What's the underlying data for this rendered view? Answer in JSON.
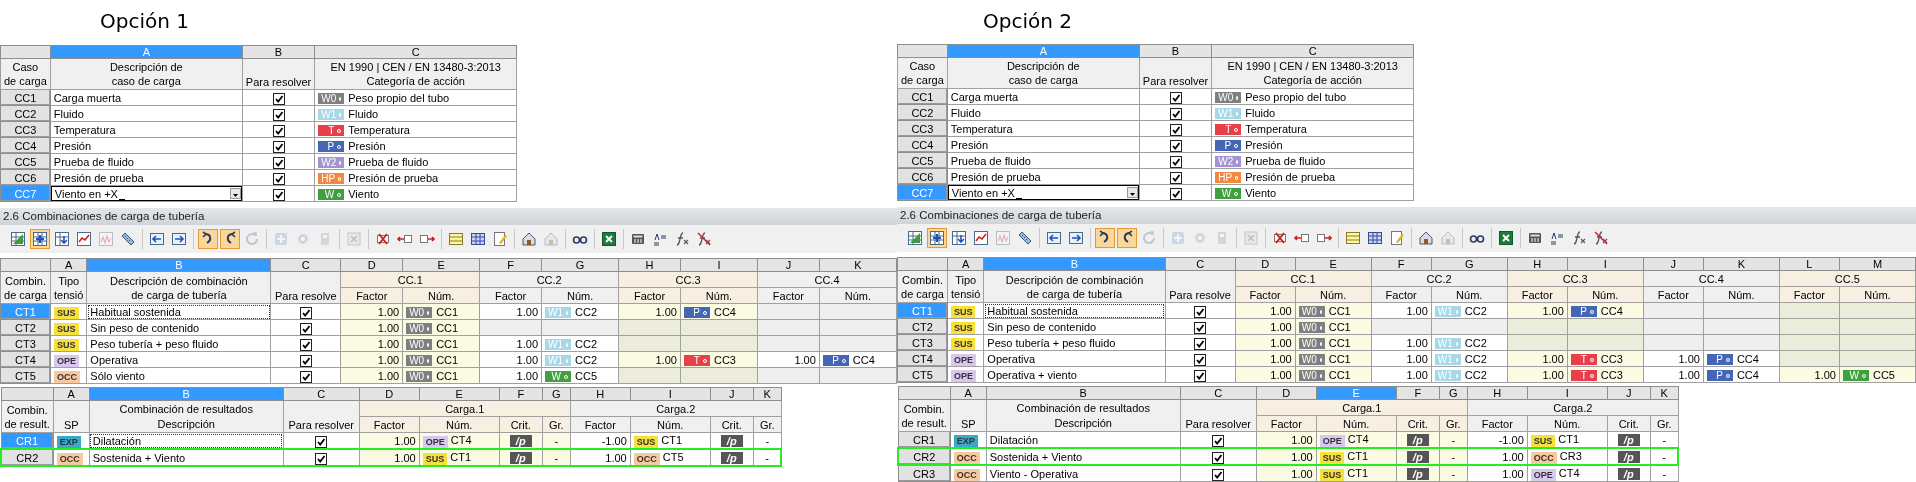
{
  "panels": [
    {
      "title": "Opción 1",
      "load_cases": {
        "corner": "Caso\nde carga",
        "columns": [
          {
            "letter": "A",
            "selected": true,
            "heading": "Descripción de\ncaso de carga"
          },
          {
            "letter": "B",
            "selected": false,
            "heading": "Para resolver"
          },
          {
            "letter": "C",
            "selected": false,
            "heading": "EN 1990 | CEN / EN 13480-3:2013\nCategoría de acción"
          }
        ],
        "rows": [
          {
            "id": "CC1",
            "selected": false,
            "description": "Carga muerta",
            "editing": false,
            "to_solve": true,
            "category": {
              "code": "W0",
              "color": "#7f7f7f",
              "label": "Peso propio del tubo"
            }
          },
          {
            "id": "CC2",
            "selected": false,
            "description": "Fluido",
            "editing": false,
            "to_solve": true,
            "category": {
              "code": "W1",
              "color": "#a6d8e8",
              "label": "Fluido"
            }
          },
          {
            "id": "CC3",
            "selected": false,
            "description": "Temperatura",
            "editing": false,
            "to_solve": true,
            "category": {
              "code": "T",
              "color": "#e8404a",
              "label": "Temperatura"
            }
          },
          {
            "id": "CC4",
            "selected": false,
            "description": "Presión",
            "editing": false,
            "to_solve": true,
            "category": {
              "code": "P",
              "color": "#4466b4",
              "label": "Presión"
            }
          },
          {
            "id": "CC5",
            "selected": false,
            "description": "Prueba de fluido",
            "editing": false,
            "to_solve": true,
            "category": {
              "code": "W2",
              "color": "#a294d0",
              "label": "Prueba de fluido"
            }
          },
          {
            "id": "CC6",
            "selected": false,
            "description": "Presión de prueba",
            "editing": false,
            "to_solve": true,
            "category": {
              "code": "HP",
              "color": "#f08840",
              "label": "Presión de prueba"
            }
          },
          {
            "id": "CC7",
            "selected": true,
            "description": "Viento en +X",
            "editing": true,
            "to_solve": true,
            "category": {
              "code": "W",
              "color": "#40a040",
              "label": "Viento"
            }
          }
        ]
      },
      "combinations": {
        "title": "2.6 Combinaciones de carga de tubería",
        "toolbar": [
          [
            {
              "kind": "grid-add",
              "pressed": false,
              "disabled": false
            },
            {
              "kind": "grid-select",
              "pressed": true,
              "disabled": false
            },
            {
              "kind": "grid-down",
              "pressed": false,
              "disabled": false
            },
            {
              "kind": "chart-red",
              "pressed": false,
              "disabled": false
            },
            {
              "kind": "chart",
              "pressed": false,
              "disabled": true
            },
            {
              "kind": "ruler",
              "pressed": false,
              "disabled": false
            }
          ],
          [
            {
              "kind": "move-left",
              "pressed": false,
              "disabled": false
            },
            {
              "kind": "move-right",
              "pressed": false,
              "disabled": false
            }
          ],
          [
            {
              "kind": "undo",
              "pressed": true,
              "disabled": false
            },
            {
              "kind": "redo",
              "pressed": true,
              "disabled": false
            },
            {
              "kind": "refresh",
              "pressed": false,
              "disabled": true
            }
          ],
          [
            {
              "kind": "plus",
              "pressed": false,
              "disabled": true
            },
            {
              "kind": "gear",
              "pressed": false,
              "disabled": true
            },
            {
              "kind": "box",
              "pressed": false,
              "disabled": true
            }
          ],
          [
            {
              "kind": "cross",
              "pressed": false,
              "disabled": true
            }
          ],
          [
            {
              "kind": "delete",
              "pressed": false,
              "disabled": false
            },
            {
              "kind": "insert-left",
              "pressed": false,
              "disabled": false
            },
            {
              "kind": "insert-right",
              "pressed": false,
              "disabled": false
            }
          ],
          [
            {
              "kind": "table-yellow",
              "pressed": false,
              "disabled": false
            },
            {
              "kind": "table-blue",
              "pressed": false,
              "disabled": false
            },
            {
              "kind": "edit",
              "pressed": false,
              "disabled": false
            }
          ],
          [
            {
              "kind": "house",
              "pressed": false,
              "disabled": false
            },
            {
              "kind": "house",
              "pressed": false,
              "disabled": true
            }
          ],
          [
            {
              "kind": "glasses",
              "pressed": false,
              "disabled": false
            }
          ],
          [
            {
              "kind": "excel",
              "pressed": false,
              "disabled": false
            }
          ],
          [
            {
              "kind": "calculator",
              "pressed": false,
              "disabled": false
            },
            {
              "kind": "text-format",
              "pressed": false,
              "disabled": false
            },
            {
              "kind": "function",
              "pressed": false,
              "disabled": false
            },
            {
              "kind": "function-cross",
              "pressed": false,
              "disabled": false
            }
          ]
        ],
        "corner": "Combin.\nde carga",
        "columns": [
          {
            "letter": "A",
            "selected": false
          },
          {
            "letter": "B",
            "selected": true
          },
          {
            "letter": "C",
            "selected": false
          },
          {
            "letter": "D",
            "selected": false
          },
          {
            "letter": "E",
            "selected": false
          },
          {
            "letter": "F",
            "selected": false
          },
          {
            "letter": "G",
            "selected": false
          },
          {
            "letter": "H",
            "selected": false
          },
          {
            "letter": "I",
            "selected": false
          },
          {
            "letter": "J",
            "selected": false
          },
          {
            "letter": "K",
            "selected": false
          }
        ],
        "fixed_headings": [
          "Tipo\ntensió",
          "Descripción de combinación\nde carga de tubería",
          "Para resolve"
        ],
        "groups": [
          {
            "title": "CC.1",
            "factor": "Factor",
            "number": "Núm."
          },
          {
            "title": "CC.2",
            "factor": "Factor",
            "number": "Núm."
          },
          {
            "title": "CC.3",
            "factor": "Factor",
            "number": "Núm."
          },
          {
            "title": "CC.4",
            "factor": "Factor",
            "number": "Núm."
          }
        ],
        "rows": [
          {
            "id": "CT1",
            "selected": true,
            "type": {
              "code": "SUS",
              "color": "#f5e03c"
            },
            "description": "Habitual sostenida",
            "focused": true,
            "to_solve": true,
            "loads": [
              {
                "empty": false,
                "factor": "1.00",
                "category": {
                  "code": "W0",
                  "color": "#7f7f7f"
                },
                "case": "CC1"
              },
              {
                "empty": false,
                "factor": "1.00",
                "category": {
                  "code": "W1",
                  "color": "#a6d8e8"
                },
                "case": "CC2"
              },
              {
                "empty": false,
                "factor": "1.00",
                "category": {
                  "code": "P",
                  "color": "#4466b4"
                },
                "case": "CC4"
              },
              {
                "empty": true
              }
            ]
          },
          {
            "id": "CT2",
            "selected": false,
            "type": {
              "code": "SUS",
              "color": "#f5e03c"
            },
            "description": "Sin peso de contenido",
            "focused": false,
            "to_solve": true,
            "loads": [
              {
                "empty": false,
                "factor": "1.00",
                "category": {
                  "code": "W0",
                  "color": "#7f7f7f"
                },
                "case": "CC1"
              },
              {
                "empty": true
              },
              {
                "empty": true
              },
              {
                "empty": true
              }
            ]
          },
          {
            "id": "CT3",
            "selected": false,
            "type": {
              "code": "SUS",
              "color": "#f5e03c"
            },
            "description": "Peso tubería + peso fluido",
            "focused": false,
            "to_solve": true,
            "loads": [
              {
                "empty": false,
                "factor": "1.00",
                "category": {
                  "code": "W0",
                  "color": "#7f7f7f"
                },
                "case": "CC1"
              },
              {
                "empty": false,
                "factor": "1.00",
                "category": {
                  "code": "W1",
                  "color": "#a6d8e8"
                },
                "case": "CC2"
              },
              {
                "empty": true
              },
              {
                "empty": true
              }
            ]
          },
          {
            "id": "CT4",
            "selected": false,
            "type": {
              "code": "OPE",
              "color": "#d8c8f0"
            },
            "description": "Operativa",
            "focused": false,
            "to_solve": true,
            "loads": [
              {
                "empty": false,
                "factor": "1.00",
                "category": {
                  "code": "W0",
                  "color": "#7f7f7f"
                },
                "case": "CC1"
              },
              {
                "empty": false,
                "factor": "1.00",
                "category": {
                  "code": "W1",
                  "color": "#a6d8e8"
                },
                "case": "CC2"
              },
              {
                "empty": false,
                "factor": "1.00",
                "category": {
                  "code": "T",
                  "color": "#e8404a"
                },
                "case": "CC3"
              },
              {
                "empty": false,
                "factor": "1.00",
                "category": {
                  "code": "P",
                  "color": "#4466b4"
                },
                "case": "CC4"
              }
            ]
          },
          {
            "id": "CT5",
            "selected": false,
            "type": {
              "code": "OCC",
              "color": "#f8c8a0"
            },
            "description": "Sólo viento",
            "focused": false,
            "to_solve": true,
            "loads": [
              {
                "empty": false,
                "factor": "1.00",
                "category": {
                  "code": "W0",
                  "color": "#7f7f7f"
                },
                "case": "CC1"
              },
              {
                "empty": false,
                "factor": "1.00",
                "category": {
                  "code": "W",
                  "color": "#40a040"
                },
                "case": "CC5"
              },
              {
                "empty": true
              },
              {
                "empty": true
              }
            ]
          }
        ]
      },
      "results": {
        "corner": "Combin.\nde result.",
        "columns": [
          {
            "letter": "A",
            "selected": false
          },
          {
            "letter": "B",
            "selected": true
          },
          {
            "letter": "C",
            "selected": false
          },
          {
            "letter": "D",
            "selected": false
          },
          {
            "letter": "E",
            "selected": false
          },
          {
            "letter": "F",
            "selected": false
          },
          {
            "letter": "G",
            "selected": false
          },
          {
            "letter": "H",
            "selected": false
          },
          {
            "letter": "I",
            "selected": false
          },
          {
            "letter": "J",
            "selected": false
          },
          {
            "letter": "K",
            "selected": false
          }
        ],
        "sp_heading": "SP",
        "description_group": "Combinación de resultados",
        "description_heading": "Descripción",
        "solve_heading": "Para resolver",
        "groups": [
          {
            "title": "Carga.1",
            "factor": "Factor",
            "number": "Núm.",
            "crit": "Crit.",
            "gr": "Gr."
          },
          {
            "title": "Carga.2",
            "factor": "Factor",
            "number": "Núm.",
            "crit": "Crit.",
            "gr": "Gr."
          }
        ],
        "rows": [
          {
            "id": "CR1",
            "selected": true,
            "highlighted": false,
            "type": {
              "code": "EXP",
              "color": "#3aa8c8"
            },
            "description": "Dilatación",
            "focused": true,
            "to_solve": true,
            "loads": [
              {
                "factor": "1.00",
                "type": {
                  "code": "OPE",
                  "color": "#d8c8f0"
                },
                "case": "CT4",
                "crit": "/p",
                "gr": "-"
              },
              {
                "factor": "-1.00",
                "type": {
                  "code": "SUS",
                  "color": "#f5e03c"
                },
                "case": "CT1",
                "crit": "/p",
                "gr": "-"
              }
            ]
          },
          {
            "id": "CR2",
            "selected": false,
            "highlighted": true,
            "type": {
              "code": "OCC",
              "color": "#f8c8a0"
            },
            "description": "Sostenida + Viento",
            "focused": false,
            "to_solve": true,
            "loads": [
              {
                "factor": "1.00",
                "type": {
                  "code": "SUS",
                  "color": "#f5e03c"
                },
                "case": "CT1",
                "crit": "/p",
                "gr": "-"
              },
              {
                "factor": "1.00",
                "type": {
                  "code": "OCC",
                  "color": "#f8c8a0"
                },
                "case": "CT5",
                "crit": "/p",
                "gr": "-"
              }
            ]
          }
        ]
      }
    },
    {
      "title": "Opción 2",
      "load_cases": {
        "corner": "Caso\nde carga",
        "columns": [
          {
            "letter": "A",
            "selected": true,
            "heading": "Descripción de\ncaso de carga"
          },
          {
            "letter": "B",
            "selected": false,
            "heading": "Para resolver"
          },
          {
            "letter": "C",
            "selected": false,
            "heading": "EN 1990 | CEN / EN 13480-3:2013\nCategoría de acción"
          }
        ],
        "rows": [
          {
            "id": "CC1",
            "selected": false,
            "description": "Carga muerta",
            "editing": false,
            "to_solve": true,
            "category": {
              "code": "W0",
              "color": "#7f7f7f",
              "label": "Peso propio del tubo"
            }
          },
          {
            "id": "CC2",
            "selected": false,
            "description": "Fluido",
            "editing": false,
            "to_solve": true,
            "category": {
              "code": "W1",
              "color": "#a6d8e8",
              "label": "Fluido"
            }
          },
          {
            "id": "CC3",
            "selected": false,
            "description": "Temperatura",
            "editing": false,
            "to_solve": true,
            "category": {
              "code": "T",
              "color": "#e8404a",
              "label": "Temperatura"
            }
          },
          {
            "id": "CC4",
            "selected": false,
            "description": "Presión",
            "editing": false,
            "to_solve": true,
            "category": {
              "code": "P",
              "color": "#4466b4",
              "label": "Presión"
            }
          },
          {
            "id": "CC5",
            "selected": false,
            "description": "Prueba de fluido",
            "editing": false,
            "to_solve": true,
            "category": {
              "code": "W2",
              "color": "#a294d0",
              "label": "Prueba de fluido"
            }
          },
          {
            "id": "CC6",
            "selected": false,
            "description": "Presión de prueba",
            "editing": false,
            "to_solve": true,
            "category": {
              "code": "HP",
              "color": "#f08840",
              "label": "Presión de prueba"
            }
          },
          {
            "id": "CC7",
            "selected": true,
            "description": "Viento en +X",
            "editing": true,
            "to_solve": true,
            "category": {
              "code": "W",
              "color": "#40a040",
              "label": "Viento"
            }
          }
        ]
      },
      "combinations": {
        "title": "2.6 Combinaciones de carga de tubería",
        "toolbar": [
          [
            {
              "kind": "grid-add",
              "pressed": false,
              "disabled": false
            },
            {
              "kind": "grid-select",
              "pressed": true,
              "disabled": false
            },
            {
              "kind": "grid-down",
              "pressed": false,
              "disabled": false
            },
            {
              "kind": "chart-red",
              "pressed": false,
              "disabled": false
            },
            {
              "kind": "chart",
              "pressed": false,
              "disabled": true
            },
            {
              "kind": "ruler",
              "pressed": false,
              "disabled": false
            }
          ],
          [
            {
              "kind": "move-left",
              "pressed": false,
              "disabled": false
            },
            {
              "kind": "move-right",
              "pressed": false,
              "disabled": false
            }
          ],
          [
            {
              "kind": "undo",
              "pressed": true,
              "disabled": false
            },
            {
              "kind": "redo",
              "pressed": true,
              "disabled": false
            },
            {
              "kind": "refresh",
              "pressed": false,
              "disabled": true
            }
          ],
          [
            {
              "kind": "plus",
              "pressed": false,
              "disabled": true
            },
            {
              "kind": "gear",
              "pressed": false,
              "disabled": true
            },
            {
              "kind": "box",
              "pressed": false,
              "disabled": true
            }
          ],
          [
            {
              "kind": "cross",
              "pressed": false,
              "disabled": true
            }
          ],
          [
            {
              "kind": "delete",
              "pressed": false,
              "disabled": false
            },
            {
              "kind": "insert-left",
              "pressed": false,
              "disabled": false
            },
            {
              "kind": "insert-right",
              "pressed": false,
              "disabled": false
            }
          ],
          [
            {
              "kind": "table-yellow",
              "pressed": false,
              "disabled": false
            },
            {
              "kind": "table-blue",
              "pressed": false,
              "disabled": false
            },
            {
              "kind": "edit",
              "pressed": false,
              "disabled": false
            }
          ],
          [
            {
              "kind": "house",
              "pressed": false,
              "disabled": false
            },
            {
              "kind": "house",
              "pressed": false,
              "disabled": true
            }
          ],
          [
            {
              "kind": "glasses",
              "pressed": false,
              "disabled": false
            }
          ],
          [
            {
              "kind": "excel",
              "pressed": false,
              "disabled": false
            }
          ],
          [
            {
              "kind": "calculator",
              "pressed": false,
              "disabled": false
            },
            {
              "kind": "text-format",
              "pressed": false,
              "disabled": false
            },
            {
              "kind": "function",
              "pressed": false,
              "disabled": false
            },
            {
              "kind": "function-cross",
              "pressed": false,
              "disabled": false
            }
          ]
        ],
        "corner": "Combin.\nde carga",
        "columns": [
          {
            "letter": "A",
            "selected": false
          },
          {
            "letter": "B",
            "selected": true
          },
          {
            "letter": "C",
            "selected": false
          },
          {
            "letter": "D",
            "selected": false
          },
          {
            "letter": "E",
            "selected": false
          },
          {
            "letter": "F",
            "selected": false
          },
          {
            "letter": "G",
            "selected": false
          },
          {
            "letter": "H",
            "selected": false
          },
          {
            "letter": "I",
            "selected": false
          },
          {
            "letter": "J",
            "selected": false
          },
          {
            "letter": "K",
            "selected": false
          },
          {
            "letter": "L",
            "selected": false
          },
          {
            "letter": "M",
            "selected": false
          }
        ],
        "fixed_headings": [
          "Tipo\ntensió",
          "Descripción de combinación\nde carga de tubería",
          "Para resolve"
        ],
        "groups": [
          {
            "title": "CC.1",
            "factor": "Factor",
            "number": "Núm."
          },
          {
            "title": "CC.2",
            "factor": "Factor",
            "number": "Núm."
          },
          {
            "title": "CC.3",
            "factor": "Factor",
            "number": "Núm."
          },
          {
            "title": "CC.4",
            "factor": "Factor",
            "number": "Núm."
          },
          {
            "title": "CC.5",
            "factor": "Factor",
            "number": "Núm."
          }
        ],
        "rows": [
          {
            "id": "CT1",
            "selected": true,
            "type": {
              "code": "SUS",
              "color": "#f5e03c"
            },
            "description": "Habitual sostenida",
            "focused": true,
            "to_solve": true,
            "loads": [
              {
                "empty": false,
                "factor": "1.00",
                "category": {
                  "code": "W0",
                  "color": "#7f7f7f"
                },
                "case": "CC1"
              },
              {
                "empty": false,
                "factor": "1.00",
                "category": {
                  "code": "W1",
                  "color": "#a6d8e8"
                },
                "case": "CC2"
              },
              {
                "empty": false,
                "factor": "1.00",
                "category": {
                  "code": "P",
                  "color": "#4466b4"
                },
                "case": "CC4"
              },
              {
                "empty": true
              },
              {
                "empty": true
              }
            ]
          },
          {
            "id": "CT2",
            "selected": false,
            "type": {
              "code": "SUS",
              "color": "#f5e03c"
            },
            "description": "Sin peso de contenido",
            "focused": false,
            "to_solve": true,
            "loads": [
              {
                "empty": false,
                "factor": "1.00",
                "category": {
                  "code": "W0",
                  "color": "#7f7f7f"
                },
                "case": "CC1"
              },
              {
                "empty": true
              },
              {
                "empty": true
              },
              {
                "empty": true
              },
              {
                "empty": true
              }
            ]
          },
          {
            "id": "CT3",
            "selected": false,
            "type": {
              "code": "SUS",
              "color": "#f5e03c"
            },
            "description": "Peso tubería + peso fluido",
            "focused": false,
            "to_solve": true,
            "loads": [
              {
                "empty": false,
                "factor": "1.00",
                "category": {
                  "code": "W0",
                  "color": "#7f7f7f"
                },
                "case": "CC1"
              },
              {
                "empty": false,
                "factor": "1.00",
                "category": {
                  "code": "W1",
                  "color": "#a6d8e8"
                },
                "case": "CC2"
              },
              {
                "empty": true
              },
              {
                "empty": true
              },
              {
                "empty": true
              }
            ]
          },
          {
            "id": "CT4",
            "selected": false,
            "type": {
              "code": "OPE",
              "color": "#d8c8f0"
            },
            "description": "Operativa",
            "focused": false,
            "to_solve": true,
            "loads": [
              {
                "empty": false,
                "factor": "1.00",
                "category": {
                  "code": "W0",
                  "color": "#7f7f7f"
                },
                "case": "CC1"
              },
              {
                "empty": false,
                "factor": "1.00",
                "category": {
                  "code": "W1",
                  "color": "#a6d8e8"
                },
                "case": "CC2"
              },
              {
                "empty": false,
                "factor": "1.00",
                "category": {
                  "code": "T",
                  "color": "#e8404a"
                },
                "case": "CC3"
              },
              {
                "empty": false,
                "factor": "1.00",
                "category": {
                  "code": "P",
                  "color": "#4466b4"
                },
                "case": "CC4"
              },
              {
                "empty": true
              }
            ]
          },
          {
            "id": "CT5",
            "selected": false,
            "type": {
              "code": "OPE",
              "color": "#d8c8f0"
            },
            "description": "Operativa + viento",
            "focused": false,
            "to_solve": true,
            "loads": [
              {
                "empty": false,
                "factor": "1.00",
                "category": {
                  "code": "W0",
                  "color": "#7f7f7f"
                },
                "case": "CC1"
              },
              {
                "empty": false,
                "factor": "1.00",
                "category": {
                  "code": "W1",
                  "color": "#a6d8e8"
                },
                "case": "CC2"
              },
              {
                "empty": false,
                "factor": "1.00",
                "category": {
                  "code": "T",
                  "color": "#e8404a"
                },
                "case": "CC3"
              },
              {
                "empty": false,
                "factor": "1.00",
                "category": {
                  "code": "P",
                  "color": "#4466b4"
                },
                "case": "CC4"
              },
              {
                "empty": false,
                "factor": "1.00",
                "category": {
                  "code": "W",
                  "color": "#40a040"
                },
                "case": "CC5"
              }
            ]
          }
        ]
      },
      "results": {
        "corner": "Combin.\nde result.",
        "columns": [
          {
            "letter": "A",
            "selected": false
          },
          {
            "letter": "B",
            "selected": false
          },
          {
            "letter": "C",
            "selected": false
          },
          {
            "letter": "D",
            "selected": false
          },
          {
            "letter": "E",
            "selected": true
          },
          {
            "letter": "F",
            "selected": false
          },
          {
            "letter": "G",
            "selected": false
          },
          {
            "letter": "H",
            "selected": false
          },
          {
            "letter": "I",
            "selected": false
          },
          {
            "letter": "J",
            "selected": false
          },
          {
            "letter": "K",
            "selected": false
          }
        ],
        "sp_heading": "SP",
        "description_group": "Combinación de resultados",
        "description_heading": "Descripción",
        "solve_heading": "Para resolver",
        "groups": [
          {
            "title": "Carga.1",
            "factor": "Factor",
            "number": "Núm.",
            "crit": "Crit.",
            "gr": "Gr."
          },
          {
            "title": "Carga.2",
            "factor": "Factor",
            "number": "Núm.",
            "crit": "Crit.",
            "gr": "Gr."
          }
        ],
        "rows": [
          {
            "id": "CR1",
            "selected": false,
            "highlighted": false,
            "type": {
              "code": "EXP",
              "color": "#3aa8c8"
            },
            "description": "Dilatación",
            "focused": false,
            "to_solve": true,
            "loads": [
              {
                "factor": "1.00",
                "type": {
                  "code": "OPE",
                  "color": "#d8c8f0"
                },
                "case": "CT4",
                "crit": "/p",
                "gr": "-"
              },
              {
                "factor": "-1.00",
                "type": {
                  "code": "SUS",
                  "color": "#f5e03c"
                },
                "case": "CT1",
                "crit": "/p",
                "gr": "-"
              }
            ]
          },
          {
            "id": "CR2",
            "selected": false,
            "highlighted": true,
            "type": {
              "code": "OCC",
              "color": "#f8c8a0"
            },
            "description": "Sostenida + Viento",
            "focused": false,
            "to_solve": true,
            "loads": [
              {
                "factor": "1.00",
                "type": {
                  "code": "SUS",
                  "color": "#f5e03c"
                },
                "case": "CT1",
                "crit": "/p",
                "gr": "-"
              },
              {
                "factor": "1.00",
                "type": {
                  "code": "OCC",
                  "color": "#f8c8a0"
                },
                "case": "CR3",
                "crit": "/p",
                "gr": "-"
              }
            ]
          },
          {
            "id": "CR3",
            "selected": false,
            "highlighted": false,
            "type": {
              "code": "OCC",
              "color": "#f8c8a0"
            },
            "description": "Viento - Operativa",
            "focused": false,
            "to_solve": true,
            "loads": [
              {
                "factor": "1.00",
                "type": {
                  "code": "SUS",
                  "color": "#f5e03c"
                },
                "case": "CT1",
                "crit": "/p",
                "gr": "-"
              },
              {
                "factor": "1.00",
                "type": {
                  "code": "OPE",
                  "color": "#d8c8f0"
                },
                "case": "CT4",
                "crit": "/p",
                "gr": "-"
              }
            ]
          }
        ]
      }
    }
  ]
}
